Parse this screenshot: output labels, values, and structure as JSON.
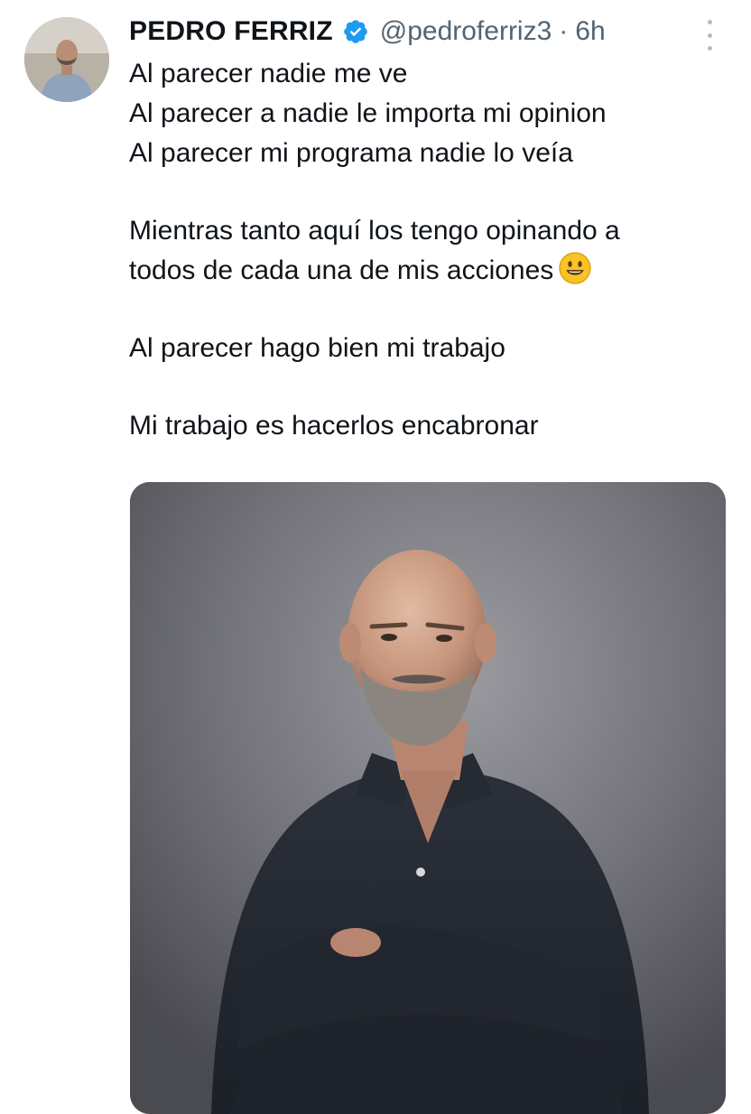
{
  "tweet": {
    "author": {
      "display_name": "PEDRO FERRIZ",
      "handle": "@pedroferriz3",
      "separator": "·",
      "time": "6h",
      "verified_icon": "verified-badge-icon",
      "avatar": "avatar-photo"
    },
    "text_lines": [
      "Al parecer nadie me ve",
      "Al parecer a nadie le importa mi opinion",
      "Al parecer mi programa nadie lo veía",
      "Mientras tanto aquí los tengo opinando a",
      "todos de cada una de mis acciones",
      "Al parecer hago bien mi trabajo",
      "Mi trabajo es hacerlos encabronar"
    ],
    "emoji": "smiling-face-emoji",
    "more_icon": "more-options-icon",
    "media": "photo-bald-bearded-man-arms-crossed"
  },
  "colors": {
    "text": "#0f1419",
    "secondary": "#536471",
    "verified": "#1d9bf0"
  }
}
